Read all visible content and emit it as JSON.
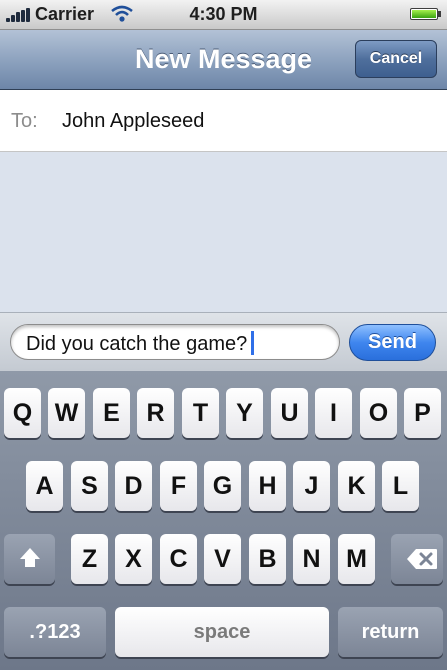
{
  "status_bar": {
    "carrier": "Carrier",
    "time": "4:30 PM",
    "icons": [
      "signal-icon",
      "wifi-icon",
      "battery-icon"
    ]
  },
  "nav_bar": {
    "title": "New Message",
    "cancel_label": "Cancel"
  },
  "to_field": {
    "label": "To:",
    "value": "John Appleseed"
  },
  "compose": {
    "message": "Did you catch the game?",
    "send_label": "Send"
  },
  "keyboard": {
    "row1": [
      "Q",
      "W",
      "E",
      "R",
      "T",
      "Y",
      "U",
      "I",
      "O",
      "P"
    ],
    "row2": [
      "A",
      "S",
      "D",
      "F",
      "G",
      "H",
      "J",
      "K",
      "L"
    ],
    "row3": [
      "Z",
      "X",
      "C",
      "V",
      "B",
      "N",
      "M"
    ],
    "numbers_label": ".?123",
    "space_label": "space",
    "return_label": "return",
    "icons": [
      "shift-icon",
      "delete-icon"
    ]
  },
  "colors": {
    "nav_bar": "#8ea3bf",
    "send_button": "#3f86ee",
    "keyboard_bg": "#7e889a",
    "conversation_bg": "#dbe2ed"
  }
}
